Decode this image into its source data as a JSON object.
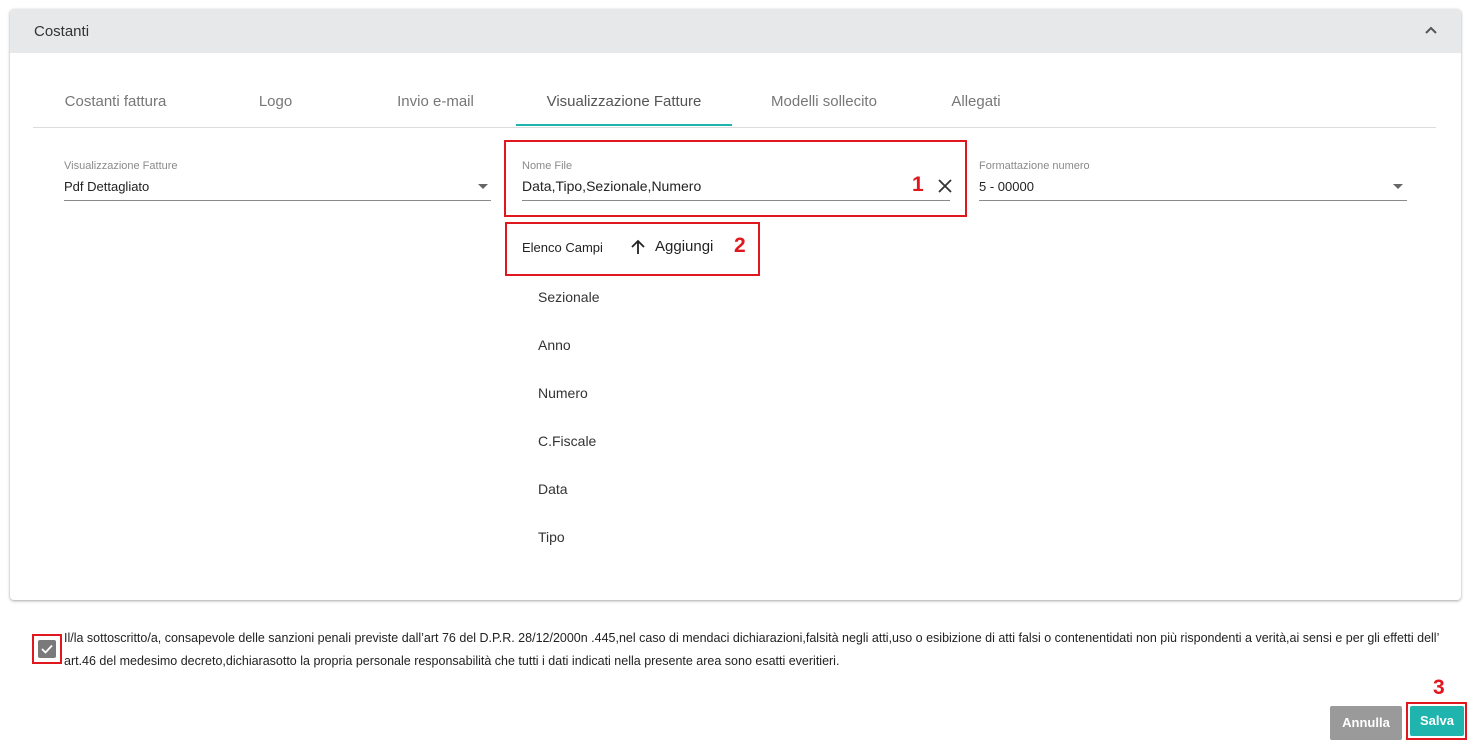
{
  "panel": {
    "title": "Costanti"
  },
  "tabs": [
    {
      "label": "Costanti fattura"
    },
    {
      "label": "Logo"
    },
    {
      "label": "Invio e-mail"
    },
    {
      "label": "Visualizzazione Fatture",
      "active": true
    },
    {
      "label": "Modelli sollecito"
    },
    {
      "label": "Allegati"
    }
  ],
  "fields": {
    "visualizzazione": {
      "label": "Visualizzazione Fatture",
      "value": "Pdf Dettagliato"
    },
    "nome_file": {
      "label": "Nome File",
      "value": "Data,Tipo,Sezionale,Numero"
    },
    "formattazione": {
      "label": "Formattazione numero",
      "value": "5 - 00000"
    }
  },
  "elenco": {
    "label": "Elenco Campi",
    "add_label": "Aggiungi",
    "items": [
      "Sezionale",
      "Anno",
      "Numero",
      "C.Fiscale",
      "Data",
      "Tipo"
    ]
  },
  "annotations": [
    "1",
    "2",
    "3"
  ],
  "declaration": {
    "checked": true,
    "text": "Il/la sottoscritto/a, consapevole delle sanzioni penali previste dall’art 76 del D.P.R. 28/12/2000n .445,nel caso di mendaci dichiarazioni,falsità negli atti,uso o esibizione di atti falsi o contenentidati non più rispondenti a verità,ai sensi e per gli effetti dell’ art.46 del medesimo decreto,dichiarasotto la propria personale responsabilità che tutti i dati indicati nella presente area sono esatti everitieri."
  },
  "buttons": {
    "cancel": "Annulla",
    "save": "Salva"
  },
  "colors": {
    "accent": "#1fb4ad",
    "annotation": "#e0171d",
    "cancel": "#9a9a9a",
    "header": "#e7e8e9"
  },
  "icons": [
    "chevron-up-icon",
    "chevron-down-icon",
    "close-icon",
    "arrow-up-icon",
    "check-icon"
  ]
}
